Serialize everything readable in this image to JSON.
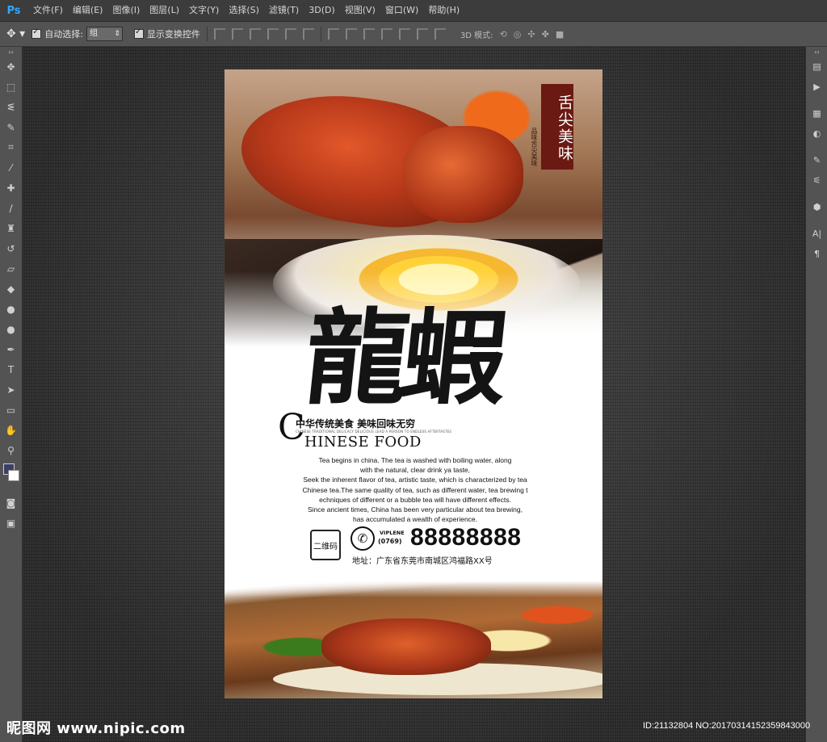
{
  "app": {
    "logo": "Ps"
  },
  "menu": [
    "文件(F)",
    "编辑(E)",
    "图像(I)",
    "图层(L)",
    "文字(Y)",
    "选择(S)",
    "滤镜(T)",
    "3D(D)",
    "视图(V)",
    "窗口(W)",
    "帮助(H)"
  ],
  "options": {
    "auto_select_label": "自动选择:",
    "auto_select_value": "组",
    "show_transform_label": "显示变换控件",
    "mode_3d_label": "3D 模式:"
  },
  "left_tools": [
    "move-tool",
    "marquee-tool",
    "lasso-tool",
    "quick-select-tool",
    "crop-tool",
    "eyedropper-tool",
    "healing-tool",
    "brush-tool",
    "clone-stamp-tool",
    "history-brush-tool",
    "eraser-tool",
    "paint-bucket-tool",
    "blur-tool",
    "dodge-tool",
    "pen-tool",
    "type-tool",
    "path-select-tool",
    "rectangle-tool",
    "hand-tool",
    "zoom-tool"
  ],
  "poster": {
    "stamp": "舌尖美味",
    "side_text": "品味舌尖美味",
    "title": "龍蝦",
    "subtitle_cn": "中华传统美食 美味回味无穷",
    "subtitle_small": "CHINESE TRADITIONAL DELICACY DELICIOUS LEAD A PERSON TO ENDLESS AFTERTASTES",
    "big_initial": "C",
    "subtitle_en": "HINESE FOOD",
    "body_lines": [
      "Tea begins in china. The tea is washed with boiling water, along",
      "with the natural, clear drink ya taste,",
      "Seek the inherent flavor of tea, artistic taste, which is characterized by tea",
      "Chinese tea.The same quality of tea, such as different water, tea brewing t",
      "echniques of different or a bubble tea will have different effects.",
      "Since ancient times, China has been very particular about tea brewing,",
      "has accumulated a wealth of experience."
    ],
    "qr_label": "二维码",
    "brand": "VIPLENE",
    "area_code": "(0769)",
    "phone": "88888888",
    "address": "地址：广东省东莞市南城区鸿福路XX号"
  },
  "watermark": {
    "left": "昵图网 www.nipic.com",
    "right": "ID:21132804 NO:20170314152359843000"
  }
}
